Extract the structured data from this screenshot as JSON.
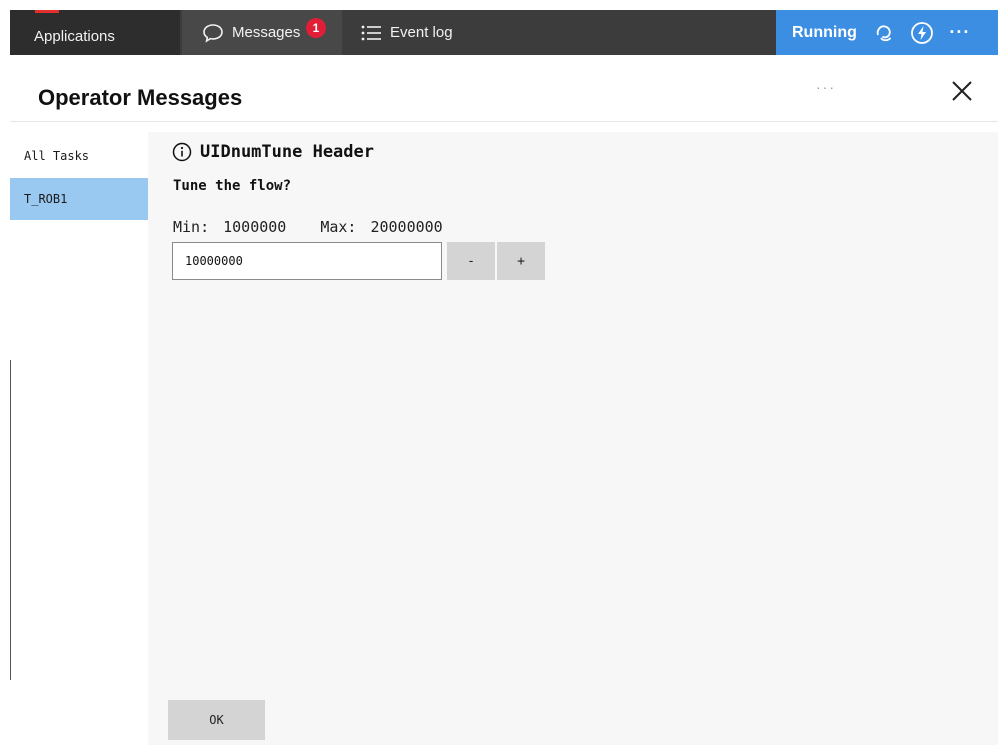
{
  "topbar": {
    "applications_label": "Applications",
    "messages_label": "Messages",
    "messages_badge": "1",
    "eventlog_label": "Event log",
    "status_label": "Running",
    "more_label": "···"
  },
  "header": {
    "title": "Operator Messages",
    "more_label": "···"
  },
  "sidebar": {
    "items": [
      {
        "label": "All Tasks"
      },
      {
        "label": "T_ROB1"
      }
    ]
  },
  "message": {
    "title": "UIDnumTune Header",
    "question": "Tune the flow?",
    "min_label": "Min:",
    "min_value": "1000000",
    "max_label": "Max:",
    "max_value": "20000000",
    "input_value": "10000000",
    "minus_label": "-",
    "plus_label": "+",
    "ok_label": "OK"
  },
  "colors": {
    "topbar_bg": "#3c3c3c",
    "status_bg": "#3c8ee2",
    "badge": "#e01e37",
    "accent_red": "#e2312c",
    "sidebar_active": "#99c8f0",
    "main_bg": "#f7f7f7",
    "button_bg": "#d4d4d4"
  },
  "icons": {
    "messages": "chat-bubble-icon",
    "eventlog": "list-icon",
    "status_cycle": "cycle-icon",
    "status_power": "bolt-icon",
    "close": "close-icon",
    "info": "info-icon"
  }
}
